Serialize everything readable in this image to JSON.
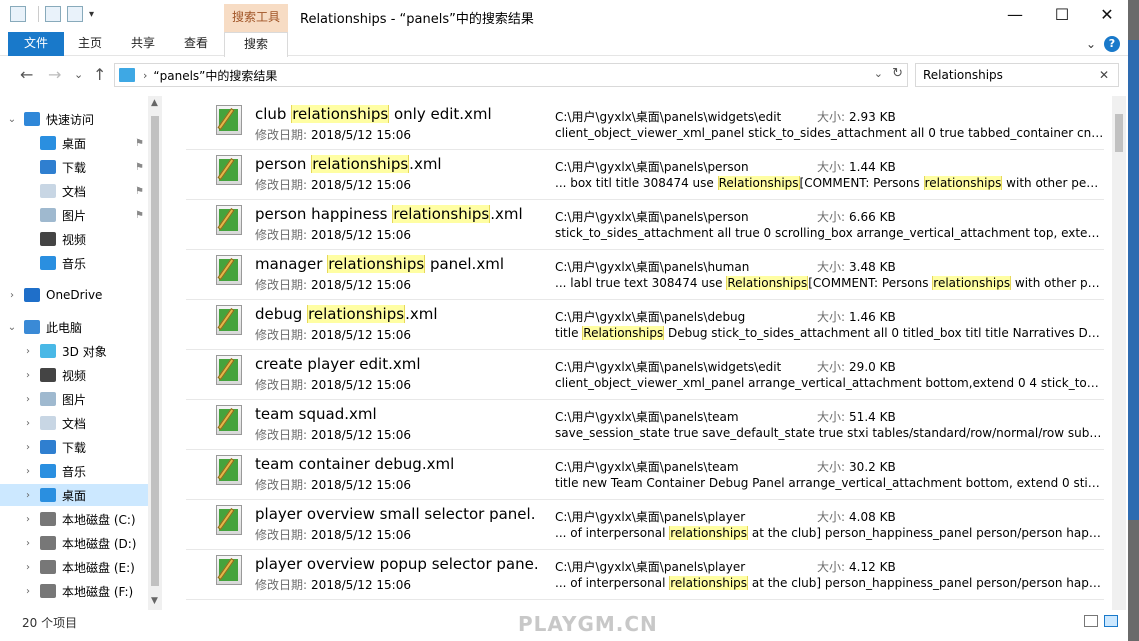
{
  "window": {
    "title": "Relationships - “panels”中的搜索结果",
    "context_tab": "搜索工具",
    "minimize": "—",
    "maximize": "☐",
    "close": "✕"
  },
  "ribbon": {
    "tabs": [
      "文件",
      "主页",
      "共享",
      "查看",
      "搜索"
    ],
    "expand": "⌄",
    "help": "?"
  },
  "address": {
    "back": "←",
    "forward": "→",
    "recent": "⌄",
    "up": "↑",
    "chevron": "›",
    "path": "“panels”中的搜索结果",
    "dropdown": "⌄",
    "refresh": "↻",
    "search_value": "Relationships",
    "search_clear": "✕"
  },
  "sidebar": {
    "items": [
      {
        "label": "快速访问",
        "exp": "⌄",
        "color": "#2f87d8",
        "pinned": false,
        "selected": false
      },
      {
        "label": "桌面",
        "exp": "",
        "color": "#2a8fe0",
        "pinned": true,
        "selected": false
      },
      {
        "label": "下载",
        "exp": "",
        "color": "#2f7fd0",
        "pinned": true,
        "selected": false
      },
      {
        "label": "文档",
        "exp": "",
        "color": "#c8d6e4",
        "pinned": true,
        "selected": false
      },
      {
        "label": "图片",
        "exp": "",
        "color": "#9fb9cf",
        "pinned": true,
        "selected": false
      },
      {
        "label": "视频",
        "exp": "",
        "color": "#444444",
        "pinned": false,
        "selected": false
      },
      {
        "label": "音乐",
        "exp": "",
        "color": "#2a8fe0",
        "pinned": false,
        "selected": false
      },
      {
        "label": "OneDrive",
        "exp": "›",
        "color": "#1f6fc9",
        "pinned": false,
        "selected": false
      },
      {
        "label": "此电脑",
        "exp": "⌄",
        "color": "#3a8ad6",
        "pinned": false,
        "selected": false
      },
      {
        "label": "3D 对象",
        "exp": "›",
        "color": "#49b8e6",
        "pinned": false,
        "selected": false
      },
      {
        "label": "视频",
        "exp": "›",
        "color": "#444444",
        "pinned": false,
        "selected": false
      },
      {
        "label": "图片",
        "exp": "›",
        "color": "#9fb9cf",
        "pinned": false,
        "selected": false
      },
      {
        "label": "文档",
        "exp": "›",
        "color": "#c8d6e4",
        "pinned": false,
        "selected": false
      },
      {
        "label": "下载",
        "exp": "›",
        "color": "#2f7fd0",
        "pinned": false,
        "selected": false
      },
      {
        "label": "音乐",
        "exp": "›",
        "color": "#2a8fe0",
        "pinned": false,
        "selected": false
      },
      {
        "label": "桌面",
        "exp": "›",
        "color": "#2a8fe0",
        "pinned": false,
        "selected": true
      },
      {
        "label": "本地磁盘 (C:)",
        "exp": "›",
        "color": "#777777",
        "pinned": false,
        "selected": false
      },
      {
        "label": "本地磁盘 (D:)",
        "exp": "›",
        "color": "#777777",
        "pinned": false,
        "selected": false
      },
      {
        "label": "本地磁盘 (E:)",
        "exp": "›",
        "color": "#777777",
        "pinned": false,
        "selected": false
      },
      {
        "label": "本地磁盘 (F:)",
        "exp": "›",
        "color": "#777777",
        "pinned": false,
        "selected": false
      }
    ],
    "pin_glyph": "⚑"
  },
  "results": {
    "date_label": "修改日期:",
    "size_label": "大小:",
    "rows": [
      {
        "name": [
          [
            "club ",
            false
          ],
          [
            "relationships",
            true
          ],
          [
            " only edit.xml",
            false
          ]
        ],
        "date": "2018/5/12 15:06",
        "path": "C:\\用户\\gyxlx\\桌面\\panels\\widgets\\edit",
        "size": "2.93 KB",
        "snippet": [
          [
            "client_object_viewer_xml_panel stick_to_sides_attachment all 0 true tabbed_container cnt4 title...",
            false
          ]
        ]
      },
      {
        "name": [
          [
            "person ",
            false
          ],
          [
            "relationships",
            true
          ],
          [
            ".xml",
            false
          ]
        ],
        "date": "2018/5/12 15:06",
        "path": "C:\\用户\\gyxlx\\桌面\\panels\\person",
        "size": "1.44 KB",
        "snippet": [
          [
            "... box titl title 308474 use ",
            false
          ],
          [
            "Relationships",
            true
          ],
          [
            "[COMMENT: Persons ",
            false
          ],
          [
            "relationships",
            true
          ],
          [
            " with other people...",
            false
          ]
        ]
      },
      {
        "name": [
          [
            "person happiness ",
            false
          ],
          [
            "relationships",
            true
          ],
          [
            ".xml",
            false
          ]
        ],
        "date": "2018/5/12 15:06",
        "path": "C:\\用户\\gyxlx\\桌面\\panels\\person",
        "size": "6.66 KB",
        "snippet": [
          [
            "stick_to_sides_attachment all true 0 scrolling_box arrange_vertical_attachment top, extend 0 8...",
            false
          ]
        ]
      },
      {
        "name": [
          [
            "manager ",
            false
          ],
          [
            "relationships",
            true
          ],
          [
            " panel.xml",
            false
          ]
        ],
        "date": "2018/5/12 15:06",
        "path": "C:\\用户\\gyxlx\\桌面\\panels\\human",
        "size": "3.48 KB",
        "snippet": [
          [
            "... labl true text 308474 use ",
            false
          ],
          [
            "Relationships",
            true
          ],
          [
            "[COMMENT: Persons ",
            false
          ],
          [
            "relationships",
            true
          ],
          [
            " with other peopl...",
            false
          ]
        ]
      },
      {
        "name": [
          [
            "debug ",
            false
          ],
          [
            "relationships",
            true
          ],
          [
            ".xml",
            false
          ]
        ],
        "date": "2018/5/12 15:06",
        "path": "C:\\用户\\gyxlx\\桌面\\panels\\debug",
        "size": "1.46 KB",
        "snippet": [
          [
            "title ",
            false
          ],
          [
            "Relationships",
            true
          ],
          [
            " Debug stick_to_sides_attachment all 0 titled_box titl title Narratives Debug ...",
            false
          ]
        ]
      },
      {
        "name": [
          [
            "create player edit.xml",
            false
          ]
        ],
        "date": "2018/5/12 15:06",
        "path": "C:\\用户\\gyxlx\\桌面\\panels\\widgets\\edit",
        "size": "29.0 KB",
        "snippet": [
          [
            "client_object_viewer_xml_panel arrange_vertical_attachment bottom,extend 0 4 stick_to_sides_...",
            false
          ]
        ]
      },
      {
        "name": [
          [
            "team squad.xml",
            false
          ]
        ],
        "date": "2018/5/12 15:06",
        "path": "C:\\用户\\gyxlx\\桌面\\panels\\team",
        "size": "51.4 KB",
        "snippet": [
          [
            "save_session_state true save_default_state true stxi tables/standard/row/normal/row subs ta...",
            false
          ]
        ]
      },
      {
        "name": [
          [
            "team container debug.xml",
            false
          ]
        ],
        "date": "2018/5/12 15:06",
        "path": "C:\\用户\\gyxlx\\桌面\\panels\\team",
        "size": "30.2 KB",
        "snippet": [
          [
            "title new Team Container Debug Panel arrange_vertical_attachment bottom, extend 0 stick_to...",
            false
          ]
        ]
      },
      {
        "name": [
          [
            "player overview small selector panel.",
            false
          ]
        ],
        "date": "2018/5/12 15:06",
        "path": "C:\\用户\\gyxlx\\桌面\\panels\\player",
        "size": "4.08 KB",
        "snippet": [
          [
            "... of interpersonal ",
            false
          ],
          [
            "relationships",
            true
          ],
          [
            " at the club] person_happiness_panel person/person happin...",
            false
          ]
        ]
      },
      {
        "name": [
          [
            "player overview popup selector pane...",
            false
          ]
        ],
        "date": "2018/5/12 15:06",
        "path": "C:\\用户\\gyxlx\\桌面\\panels\\player",
        "size": "4.12 KB",
        "snippet": [
          [
            "... of interpersonal ",
            false
          ],
          [
            "relationships",
            true
          ],
          [
            " at the club] person_happiness_panel person/person happin...",
            false
          ]
        ]
      }
    ]
  },
  "status": {
    "count": "20 个项目"
  },
  "watermark": "PLAYGM.CN"
}
